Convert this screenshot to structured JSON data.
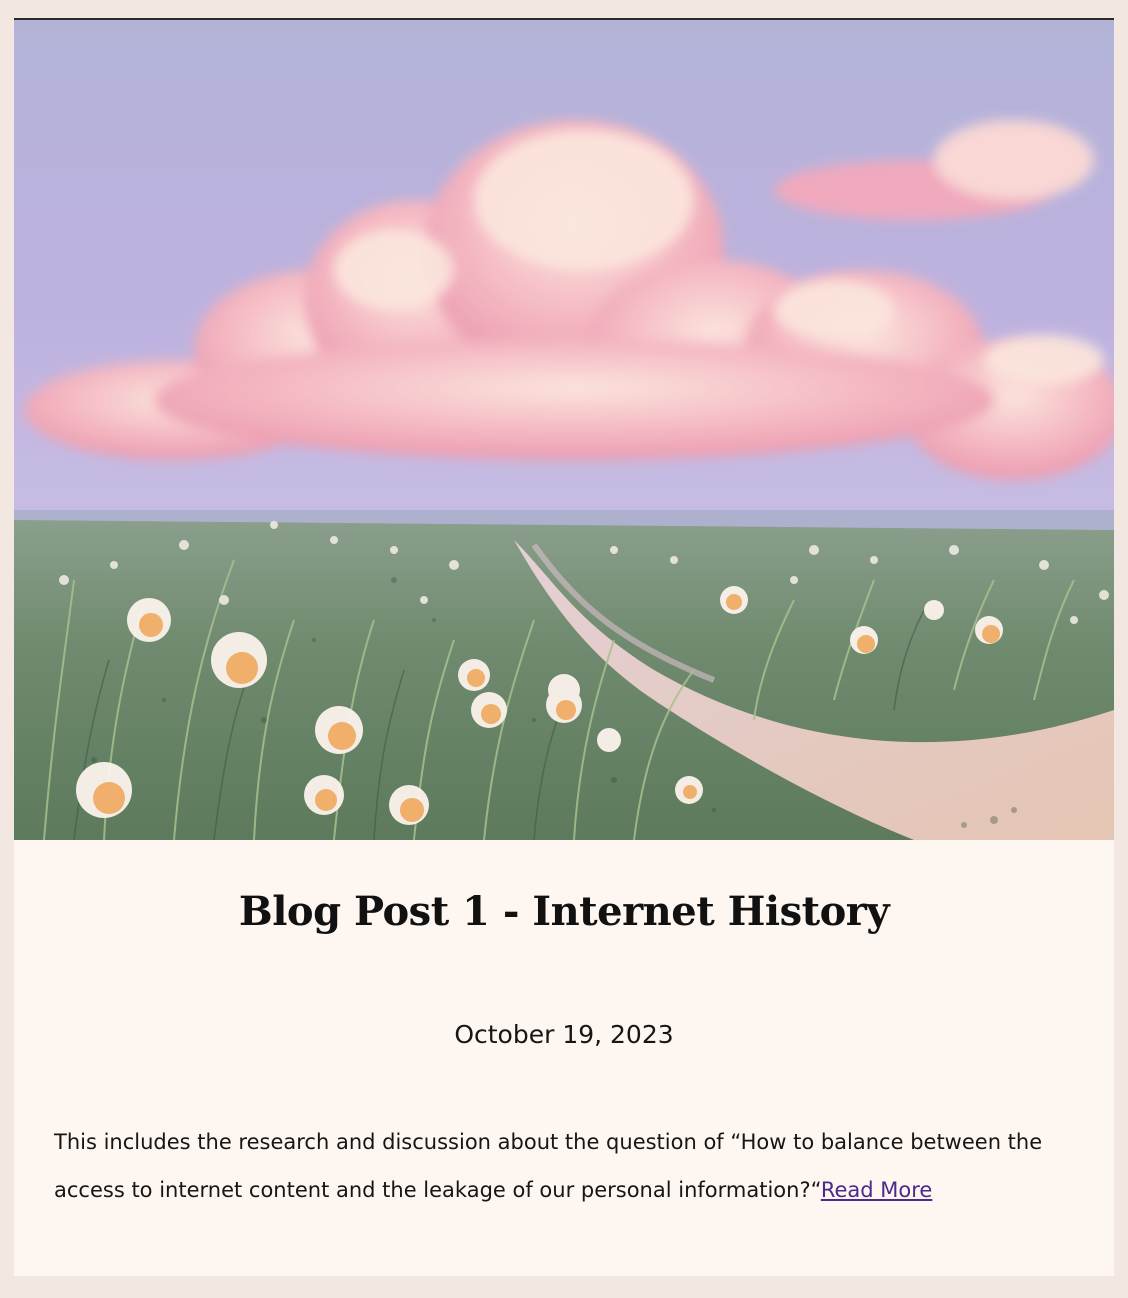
{
  "post": {
    "title": "Blog Post 1 - Internet History",
    "date": "October 19, 2023",
    "excerpt": "This includes the research and discussion about the question of “How to balance between the access to internet content and the leakage of our personal information?“",
    "read_more_label": "Read More"
  },
  "hero_image": {
    "description_icon": "painted-landscape-illustration"
  },
  "colors": {
    "page_background": "#f3e7e1",
    "card_background": "#fdf6f1",
    "link": "#4a2a8a",
    "text": "#161616"
  }
}
